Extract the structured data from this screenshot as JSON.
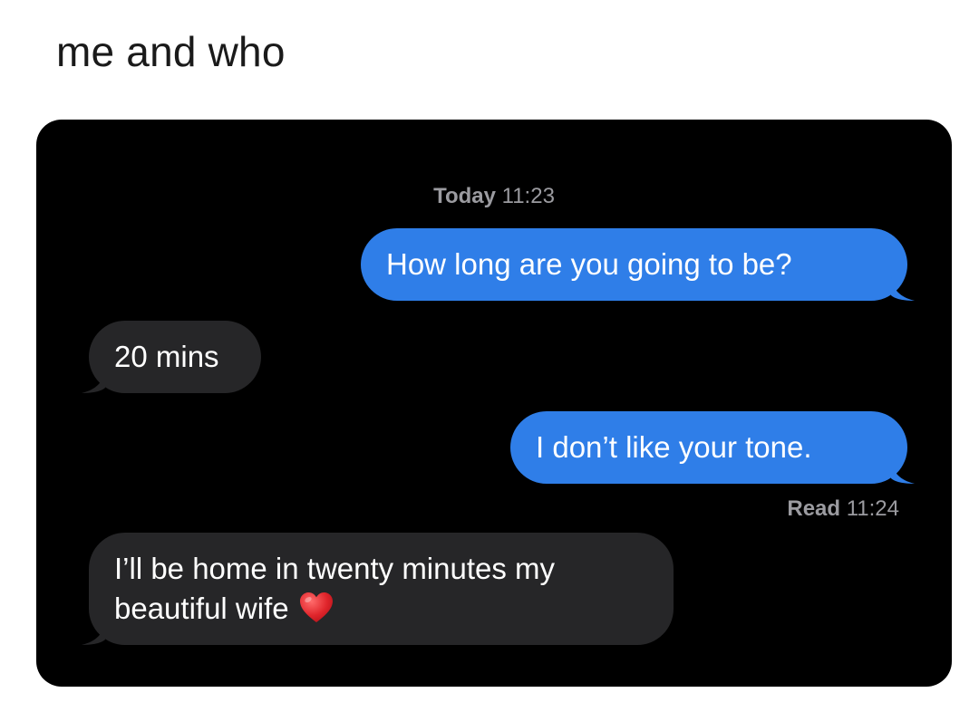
{
  "caption": "me and who",
  "conversation": {
    "timestamp_prefix": "Today",
    "timestamp_time": "11:23",
    "receipt_prefix": "Read",
    "receipt_time": "11:24",
    "messages": [
      {
        "direction": "sent",
        "text": "How long are you going to be?"
      },
      {
        "direction": "received",
        "text": "20 mins"
      },
      {
        "direction": "sent",
        "text": "I don’t like your tone."
      },
      {
        "direction": "received",
        "text": "I’ll be home in twenty minutes my beautiful wife",
        "emoji": "heart-icon"
      }
    ]
  },
  "colors": {
    "sent_bubble": "#2f7ee8",
    "received_bubble": "#262628",
    "background": "#000000",
    "meta_text": "#9b9ba0"
  }
}
